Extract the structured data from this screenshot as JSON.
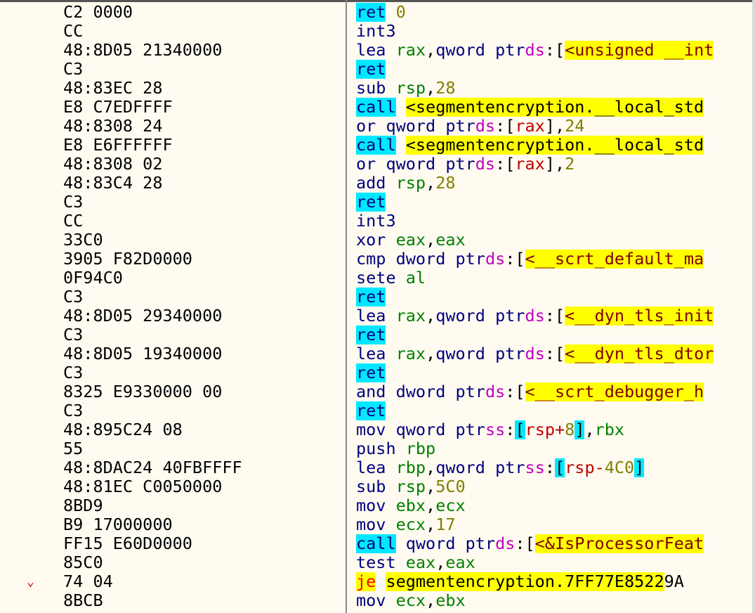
{
  "rows": [
    {
      "bytes": "C2 0000",
      "mnemonic": "ret",
      "mn_hl": "cyan",
      "ops": [
        {
          "t": "num",
          "v": " 0"
        }
      ]
    },
    {
      "bytes": "CC",
      "mnemonic": "int3",
      "mn_hl": "",
      "ops": []
    },
    {
      "bytes": "48:8D05 21340000",
      "mnemonic": "lea",
      "mn_hl": "",
      "ops": [
        {
          "t": "reg",
          "v": " rax"
        },
        {
          "t": "comma",
          "v": ","
        },
        {
          "t": "sz",
          "v": "qword ptr"
        },
        {
          "t": "seg",
          "v": "ds"
        },
        {
          "t": "comma",
          "v": ":["
        },
        {
          "t": "sym",
          "v": "<unsigned __int"
        }
      ]
    },
    {
      "bytes": "C3",
      "mnemonic": "ret",
      "mn_hl": "cyan",
      "ops": []
    },
    {
      "bytes": "48:83EC 28",
      "mnemonic": "sub",
      "mn_hl": "",
      "ops": [
        {
          "t": "reg",
          "v": " rsp"
        },
        {
          "t": "comma",
          "v": ","
        },
        {
          "t": "num",
          "v": "28"
        }
      ]
    },
    {
      "bytes": "E8 C7EDFFFF",
      "mnemonic": "call",
      "mn_hl": "cyan",
      "ops": [
        {
          "t": "plain",
          "v": " "
        },
        {
          "t": "tgt",
          "v": "<segmentencryption.__local_std"
        }
      ]
    },
    {
      "bytes": "48:8308 24",
      "mnemonic": "or",
      "mn_hl": "",
      "ops": [
        {
          "t": "sz",
          "v": " qword ptr"
        },
        {
          "t": "seg",
          "v": "ds"
        },
        {
          "t": "comma",
          "v": ":["
        },
        {
          "t": "mem",
          "v": "rax"
        },
        {
          "t": "comma",
          "v": "],"
        },
        {
          "t": "num",
          "v": "24"
        }
      ]
    },
    {
      "bytes": "E8 E6FFFFFF",
      "mnemonic": "call",
      "mn_hl": "cyan",
      "ops": [
        {
          "t": "plain",
          "v": " "
        },
        {
          "t": "tgt",
          "v": "<segmentencryption.__local_std"
        }
      ]
    },
    {
      "bytes": "48:8308 02",
      "mnemonic": "or",
      "mn_hl": "",
      "ops": [
        {
          "t": "sz",
          "v": " qword ptr"
        },
        {
          "t": "seg",
          "v": "ds"
        },
        {
          "t": "comma",
          "v": ":["
        },
        {
          "t": "mem",
          "v": "rax"
        },
        {
          "t": "comma",
          "v": "],"
        },
        {
          "t": "num",
          "v": "2"
        }
      ]
    },
    {
      "bytes": "48:83C4 28",
      "mnemonic": "add",
      "mn_hl": "",
      "ops": [
        {
          "t": "reg",
          "v": " rsp"
        },
        {
          "t": "comma",
          "v": ","
        },
        {
          "t": "num",
          "v": "28"
        }
      ]
    },
    {
      "bytes": "C3",
      "mnemonic": "ret",
      "mn_hl": "cyan",
      "ops": []
    },
    {
      "bytes": "CC",
      "mnemonic": "int3",
      "mn_hl": "",
      "ops": []
    },
    {
      "bytes": "33C0",
      "mnemonic": "xor",
      "mn_hl": "",
      "ops": [
        {
          "t": "reg",
          "v": " eax"
        },
        {
          "t": "comma",
          "v": ","
        },
        {
          "t": "reg",
          "v": "eax"
        }
      ]
    },
    {
      "bytes": "3905 F82D0000",
      "mnemonic": "cmp",
      "mn_hl": "",
      "ops": [
        {
          "t": "sz",
          "v": " dword ptr"
        },
        {
          "t": "seg",
          "v": "ds"
        },
        {
          "t": "comma",
          "v": ":["
        },
        {
          "t": "sym",
          "v": "<__scrt_default_ma"
        }
      ]
    },
    {
      "bytes": "0F94C0",
      "mnemonic": "sete",
      "mn_hl": "",
      "ops": [
        {
          "t": "reg",
          "v": " al"
        }
      ]
    },
    {
      "bytes": "C3",
      "mnemonic": "ret",
      "mn_hl": "cyan",
      "ops": []
    },
    {
      "bytes": "48:8D05 29340000",
      "mnemonic": "lea",
      "mn_hl": "",
      "ops": [
        {
          "t": "reg",
          "v": " rax"
        },
        {
          "t": "comma",
          "v": ","
        },
        {
          "t": "sz",
          "v": "qword ptr"
        },
        {
          "t": "seg",
          "v": "ds"
        },
        {
          "t": "comma",
          "v": ":["
        },
        {
          "t": "sym",
          "v": "<__dyn_tls_init"
        }
      ]
    },
    {
      "bytes": "C3",
      "mnemonic": "ret",
      "mn_hl": "cyan",
      "ops": []
    },
    {
      "bytes": "48:8D05 19340000",
      "mnemonic": "lea",
      "mn_hl": "",
      "ops": [
        {
          "t": "reg",
          "v": " rax"
        },
        {
          "t": "comma",
          "v": ","
        },
        {
          "t": "sz",
          "v": "qword ptr"
        },
        {
          "t": "seg",
          "v": "ds"
        },
        {
          "t": "comma",
          "v": ":["
        },
        {
          "t": "sym",
          "v": "<__dyn_tls_dtor"
        }
      ]
    },
    {
      "bytes": "C3",
      "mnemonic": "ret",
      "mn_hl": "cyan",
      "ops": []
    },
    {
      "bytes": "8325 E9330000 00",
      "mnemonic": "and",
      "mn_hl": "",
      "ops": [
        {
          "t": "sz",
          "v": " dword ptr"
        },
        {
          "t": "seg",
          "v": "ds"
        },
        {
          "t": "comma",
          "v": ":["
        },
        {
          "t": "sym",
          "v": "<__scrt_debugger_h"
        }
      ]
    },
    {
      "bytes": "C3",
      "mnemonic": "ret",
      "mn_hl": "cyan",
      "ops": []
    },
    {
      "bytes": "48:895C24 08",
      "mnemonic": "mov",
      "mn_hl": "",
      "ops": [
        {
          "t": "sz",
          "v": " qword ptr"
        },
        {
          "t": "seg",
          "v": "ss"
        },
        {
          "t": "comma",
          "v": ":"
        },
        {
          "t": "brkc",
          "v": "["
        },
        {
          "t": "mem",
          "v": "rsp"
        },
        {
          "t": "memplus",
          "v": "+"
        },
        {
          "t": "num",
          "v": "8"
        },
        {
          "t": "brkc",
          "v": "]"
        },
        {
          "t": "comma",
          "v": ","
        },
        {
          "t": "reg",
          "v": "rbx"
        }
      ]
    },
    {
      "bytes": "55",
      "mnemonic": "push",
      "mn_hl": "",
      "ops": [
        {
          "t": "reg",
          "v": " rbp"
        }
      ]
    },
    {
      "bytes": "48:8DAC24 40FBFFFF",
      "mnemonic": "lea",
      "mn_hl": "",
      "ops": [
        {
          "t": "reg",
          "v": " rbp"
        },
        {
          "t": "comma",
          "v": ","
        },
        {
          "t": "sz",
          "v": "qword ptr"
        },
        {
          "t": "seg",
          "v": "ss"
        },
        {
          "t": "comma",
          "v": ":"
        },
        {
          "t": "brkc",
          "v": "["
        },
        {
          "t": "mem",
          "v": "rsp"
        },
        {
          "t": "memplus",
          "v": "-"
        },
        {
          "t": "num",
          "v": "4C0"
        },
        {
          "t": "brkc",
          "v": "]"
        }
      ]
    },
    {
      "bytes": "48:81EC C0050000",
      "mnemonic": "sub",
      "mn_hl": "",
      "ops": [
        {
          "t": "reg",
          "v": " rsp"
        },
        {
          "t": "comma",
          "v": ","
        },
        {
          "t": "num",
          "v": "5C0"
        }
      ]
    },
    {
      "bytes": "8BD9",
      "mnemonic": "mov",
      "mn_hl": "",
      "ops": [
        {
          "t": "reg",
          "v": " ebx"
        },
        {
          "t": "comma",
          "v": ","
        },
        {
          "t": "reg",
          "v": "ecx"
        }
      ]
    },
    {
      "bytes": "B9 17000000",
      "mnemonic": "mov",
      "mn_hl": "",
      "ops": [
        {
          "t": "reg",
          "v": " ecx"
        },
        {
          "t": "comma",
          "v": ","
        },
        {
          "t": "num",
          "v": "17"
        }
      ]
    },
    {
      "bytes": "FF15 E60D0000",
      "mnemonic": "call",
      "mn_hl": "cyan",
      "ops": [
        {
          "t": "sz",
          "v": " qword ptr"
        },
        {
          "t": "seg",
          "v": "ds"
        },
        {
          "t": "comma",
          "v": ":["
        },
        {
          "t": "sym",
          "v": "<&IsProcessorFeat"
        }
      ]
    },
    {
      "bytes": "85C0",
      "mnemonic": "test",
      "mn_hl": "",
      "ops": [
        {
          "t": "reg",
          "v": " eax"
        },
        {
          "t": "comma",
          "v": ","
        },
        {
          "t": "reg",
          "v": "eax"
        }
      ]
    },
    {
      "bytes": "74 04",
      "mnemonic": "je",
      "mn_hl": "yellow",
      "arrow": "⌄",
      "ops": [
        {
          "t": "plain",
          "v": " "
        },
        {
          "t": "tgt",
          "v": "segmentencryption.7FF77E8522"
        },
        {
          "t": "plain",
          "v": "9A"
        }
      ]
    },
    {
      "bytes": "8BCB",
      "mnemonic": "mov",
      "mn_hl": "",
      "ops": [
        {
          "t": "reg",
          "v": " ecx"
        },
        {
          "t": "comma",
          "v": ","
        },
        {
          "t": "reg",
          "v": "ebx"
        }
      ]
    }
  ]
}
